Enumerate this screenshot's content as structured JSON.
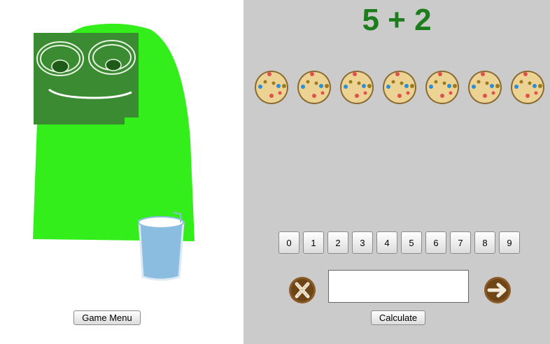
{
  "game": {
    "menu_label": "Game Menu",
    "problem": "5 + 2",
    "cookie_count": 7,
    "digits": [
      "0",
      "1",
      "2",
      "3",
      "4",
      "5",
      "6",
      "7",
      "8",
      "9"
    ],
    "answer_value": "",
    "calculate_label": "Calculate"
  },
  "colors": {
    "panel_bg": "#cbcbcb",
    "problem_text": "#1b7d1b",
    "monster_body": "#33ee1a",
    "monster_face": "#3b8b32",
    "glass": "#8bbde0"
  },
  "icons": {
    "clear": "x-cookie-icon",
    "submit": "arrow-cookie-icon",
    "cookie": "cookie-icon"
  }
}
